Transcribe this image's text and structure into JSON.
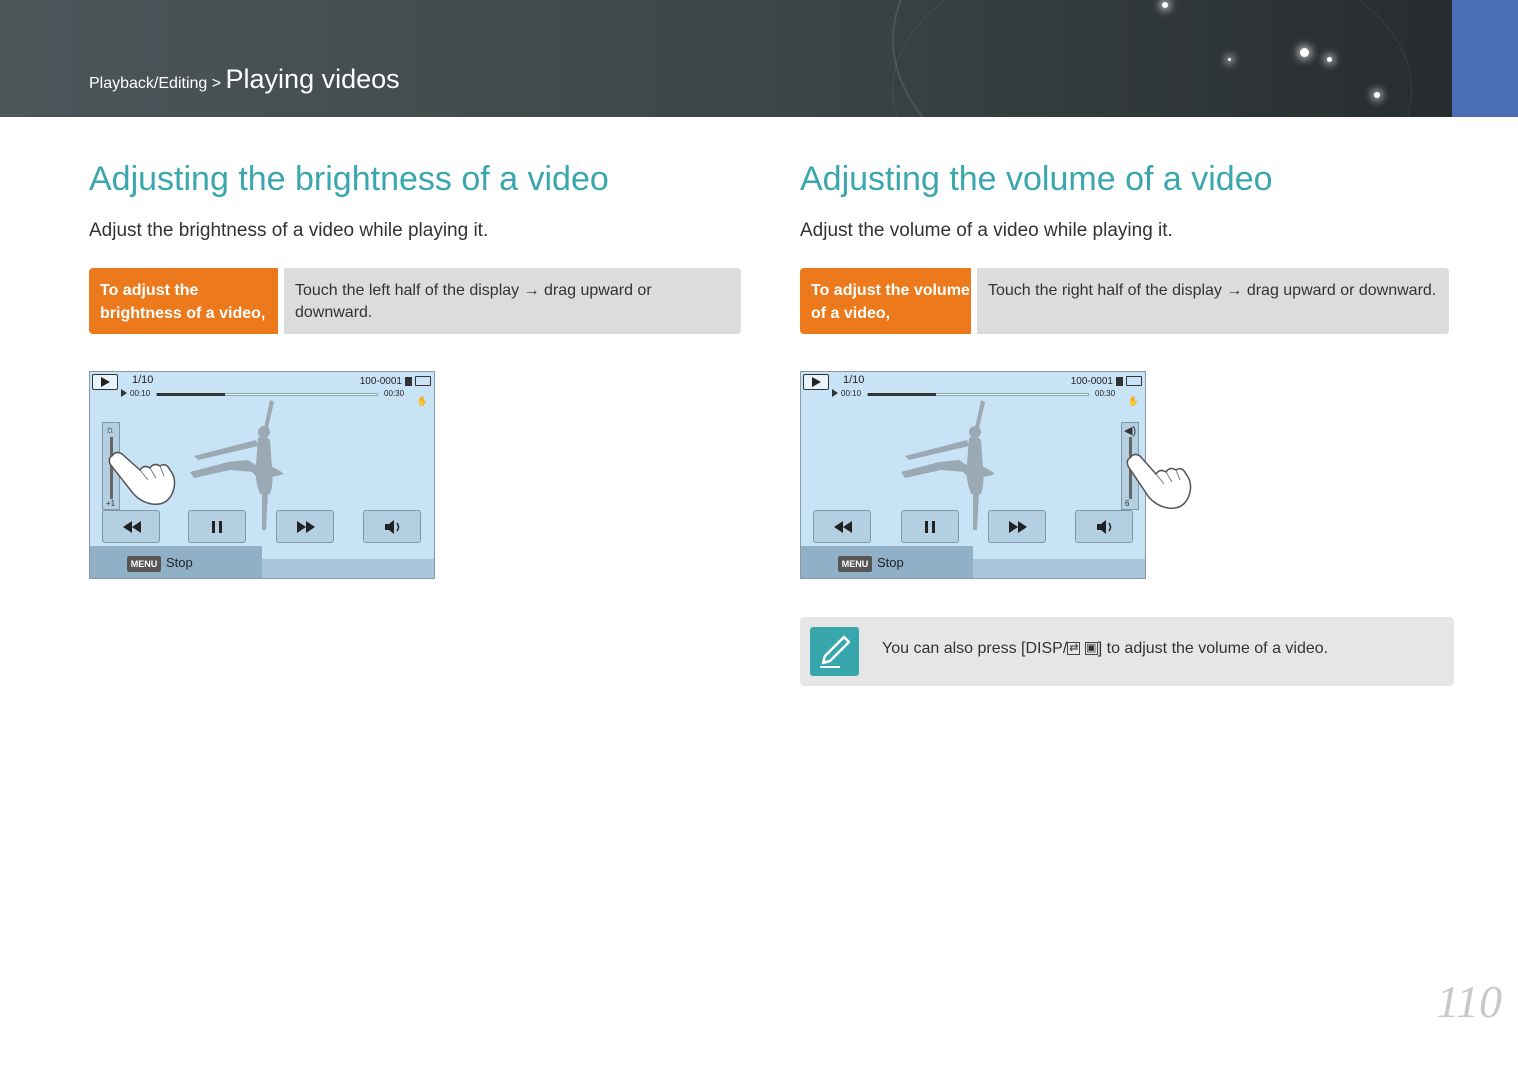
{
  "header": {
    "breadcrumb_parent": "Playback/Editing",
    "breadcrumb_sep": " > ",
    "breadcrumb_current": "Playing videos"
  },
  "left": {
    "title": "Adjusting the brightness of a video",
    "description": "Adjust the brightness of a video while playing it.",
    "instruction_label": "To adjust the brightness of a video,",
    "instruction_text": "Touch the left half of the display → drag upward or downward.",
    "screen": {
      "count": "1/10",
      "file_no": "100-0001",
      "time_current": "00:10",
      "time_total": "00:30",
      "progress_fraction": 0.31,
      "slider_symbol": "☼",
      "slider_value": "+1",
      "menu_key": "MENU",
      "stop_label": "Stop"
    }
  },
  "right": {
    "title": "Adjusting the volume of a video",
    "description": "Adjust the volume of a video while playing it.",
    "instruction_label": "To adjust the volume of a video,",
    "instruction_text": "Touch the right half of the display → drag upward or downward.",
    "screen": {
      "count": "1/10",
      "file_no": "100-0001",
      "time_current": "00:10",
      "time_total": "00:30",
      "progress_fraction": 0.31,
      "slider_symbol": "◀)",
      "slider_value": "6",
      "menu_key": "MENU",
      "stop_label": "Stop"
    },
    "note": {
      "prefix": "You can also press [",
      "key_disp": "DISP",
      "separator": "/",
      "suffix": "] to adjust the volume of a video."
    }
  },
  "page_number": "110",
  "colors": {
    "accent_teal": "#3aa6ad",
    "label_orange": "#ec7a1c",
    "tab_blue": "#4a6db5"
  },
  "icons": [
    "play-mode-icon",
    "memory-card-icon",
    "battery-icon",
    "rewind-icon",
    "pause-icon",
    "fast-forward-icon",
    "volume-icon",
    "brightness-icon",
    "hand-pointer-icon",
    "note-pencil-icon"
  ]
}
